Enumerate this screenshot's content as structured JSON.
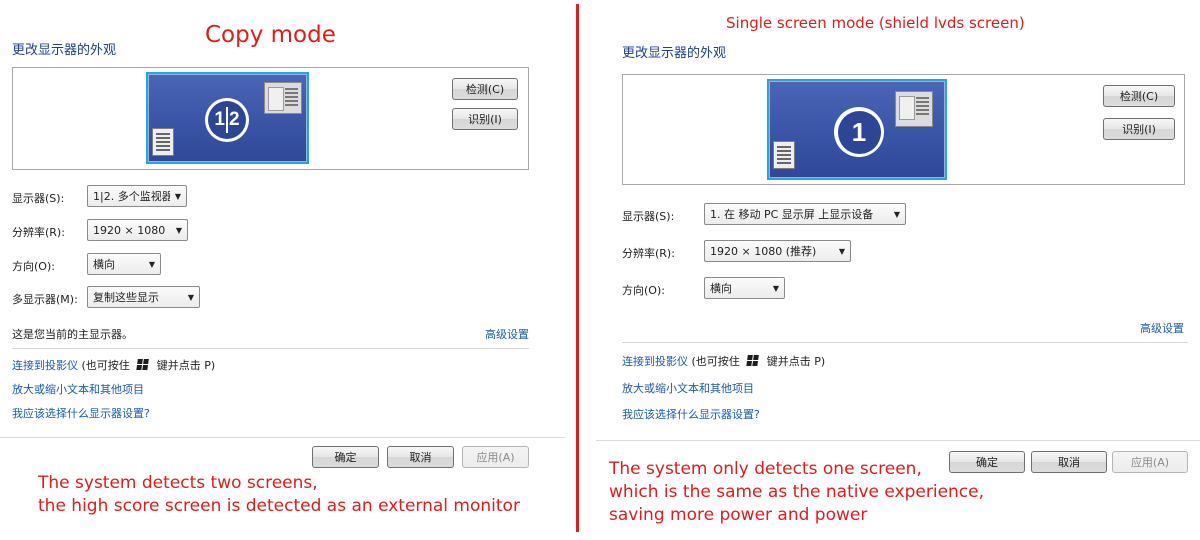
{
  "left": {
    "mode_title": "Copy mode",
    "heading": "更改显示器的外观",
    "preview": {
      "badge_left": "1",
      "badge_right": "2"
    },
    "buttons": {
      "detect": "检测(C)",
      "identify": "识别(I)"
    },
    "fields": [
      {
        "label": "显示器(S):",
        "value": "1|2. 多个监视器"
      },
      {
        "label": "分辨率(R):",
        "value": "1920 × 1080"
      },
      {
        "label": "方向(O):",
        "value": "横向"
      },
      {
        "label": "多显示器(M):",
        "value": "复制这些显示"
      }
    ],
    "primary_note": "这是您当前的主显示器。",
    "advanced_link": "高级设置",
    "connect_link": "连接到投影仪",
    "connect_hint_before": "(也可按住",
    "connect_hint_after": "键并点击 P)",
    "link_enlarge": "放大或缩小文本和其他项目",
    "link_which": "我应该选择什么显示器设置?",
    "footer": {
      "ok": "确定",
      "cancel": "取消",
      "apply": "应用(A)"
    },
    "annotation": [
      "The system detects two screens,",
      "the high score screen is detected as an external monitor"
    ]
  },
  "right": {
    "mode_title": "Single screen mode (shield lvds screen)",
    "heading": "更改显示器的外观",
    "preview": {
      "badge": "1"
    },
    "buttons": {
      "detect": "检测(C)",
      "identify": "识别(I)"
    },
    "fields": [
      {
        "label": "显示器(S):",
        "value": "1. 在 移动 PC 显示屏 上显示设备"
      },
      {
        "label": "分辨率(R):",
        "value": "1920 × 1080 (推荐)"
      },
      {
        "label": "方向(O):",
        "value": "横向"
      }
    ],
    "advanced_link": "高级设置",
    "connect_link": "连接到投影仪",
    "connect_hint_before": "(也可按住",
    "connect_hint_after": "键并点击 P)",
    "link_enlarge": "放大或缩小文本和其他项目",
    "link_which": "我应该选择什么显示器设置?",
    "footer": {
      "ok": "确定",
      "cancel": "取消",
      "apply": "应用(A)"
    },
    "annotation": [
      "The system only detects one screen,",
      "which is the same as the native experience,",
      "saving more power and power"
    ]
  },
  "colors": {
    "annotation_red": "#e31b1b",
    "link_blue": "#1a5ab5",
    "heading_blue": "#1f3f8f",
    "monitor_blue": "#3a54a6"
  },
  "icons": {
    "dropdown": "chevron-down-icon",
    "windows_key": "windows-logo-icon"
  }
}
